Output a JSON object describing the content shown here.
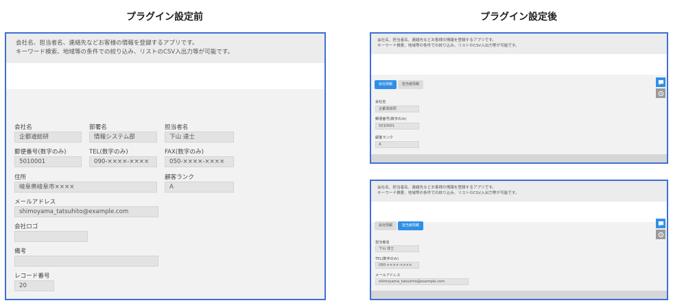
{
  "headings": {
    "before": "プラグイン設定前",
    "after": "プラグイン設定後"
  },
  "description": {
    "line1": "会社名、担当者名、連絡先などお客様の情報を登録するアプリです。",
    "line2": "キーワード検索、地域等の条件での絞り込み、リストのCSV入出力等が可能です。"
  },
  "before": {
    "company_label": "会社名",
    "company_value": "企都道総研",
    "department_label": "部署名",
    "department_value": "情報システム部",
    "person_label": "担当者名",
    "person_value": "下山 達士",
    "zip_label": "郵便番号(数字のみ)",
    "zip_value": "5010001",
    "tel_label": "TEL(数字のみ)",
    "tel_value": "090-××××-××××",
    "fax_label": "FAX(数字のみ)",
    "fax_value": "050-××××-××××",
    "address_label": "住所",
    "address_value": "岐阜県岐阜市××××",
    "rank_label": "顧客ランク",
    "rank_value": "A",
    "email_label": "メールアドレス",
    "email_value": "shimoyama_tatsuhito@example.com",
    "logo_label": "会社ロゴ",
    "logo_value": "",
    "notes_label": "備考",
    "notes_value": "",
    "record_label": "レコード番号",
    "record_value": "20"
  },
  "after_company_tab": {
    "tab_company": "会社情報",
    "tab_person": "担当者情報",
    "company_label": "会社名",
    "company_value": "企都道総研",
    "zip_label": "郵便番号(数字のみ)",
    "zip_value": "5010001",
    "rank_label": "顧客ランク",
    "rank_value": "A"
  },
  "after_person_tab": {
    "tab_company": "会社情報",
    "tab_person": "担当者情報",
    "person_label": "担当者名",
    "person_value": "下山 達士",
    "tel_label": "TEL(数字のみ)",
    "tel_value": "090-××××-××××",
    "email_label": "メールアドレス",
    "email_value": "shimoyama_tatsuhito@example.com"
  },
  "icons": {
    "comment": "comment-icon",
    "history": "history-icon"
  },
  "colors": {
    "frame_border": "#3b6fd4",
    "tab_active": "#2f8fe8",
    "comment_button": "#2f8fe8",
    "history_button": "#9a9a9a"
  }
}
